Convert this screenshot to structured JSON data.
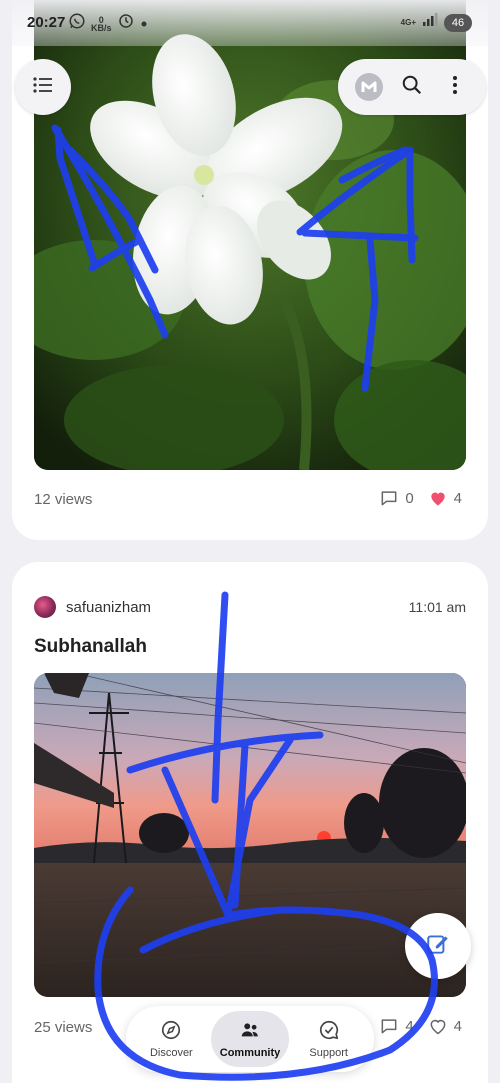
{
  "status_bar": {
    "time": "20:27",
    "data_speed_value": "0",
    "data_speed_unit": "KB/s",
    "network_type": "4G+",
    "battery": "46"
  },
  "top_controls": {
    "menu_icon": "list-menu-icon",
    "logo_icon": "app-logo-icon",
    "search_icon": "search-icon",
    "more_icon": "more-vertical-icon"
  },
  "posts": [
    {
      "views": "12 views",
      "comments": "0",
      "likes": "4",
      "liked": true
    },
    {
      "username": "safuanizham",
      "time": "11:01 am",
      "title": "Subhanallah",
      "views": "25 views",
      "comments": "4",
      "likes": "4",
      "liked": false
    }
  ],
  "bottom_nav": {
    "items": [
      {
        "label": "Discover",
        "icon": "compass-icon",
        "active": false
      },
      {
        "label": "Community",
        "icon": "people-icon",
        "active": true
      },
      {
        "label": "Support",
        "icon": "chat-check-icon",
        "active": false
      }
    ]
  },
  "colors": {
    "accent_heart": "#f0506e",
    "marker": "#1e3ff0",
    "background": "#f0eff4"
  }
}
